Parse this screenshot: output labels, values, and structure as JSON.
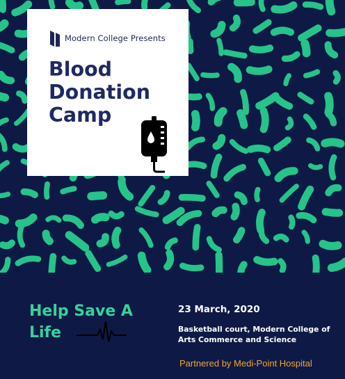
{
  "colors": {
    "background": "#0e1a45",
    "pattern": "#26c38a",
    "card": "#ffffff",
    "title": "#1e2a62",
    "accent_green": "#34d39a",
    "partner_orange": "#f3a532"
  },
  "card": {
    "presenter": "Modern College Presents",
    "title": "Blood Donation Camp",
    "logo_icon": "college-logo-icon",
    "bag_icon": "iv-blood-bag-icon"
  },
  "footer": {
    "slogan": "Help Save A Life",
    "pulse_icon": "heartbeat-line-icon",
    "date": "23 March, 2020",
    "venue": "Basketball court, Modern College of Arts Commerce and Science",
    "partner": "Partnered by Medi-Point Hospital"
  }
}
